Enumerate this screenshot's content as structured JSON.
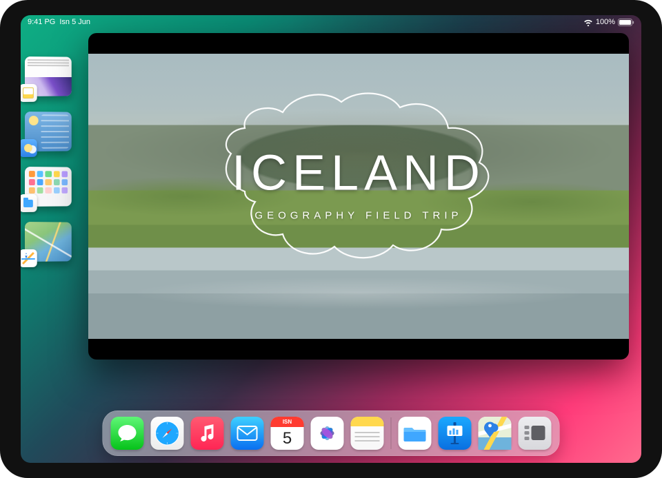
{
  "status": {
    "time": "9:41 PG",
    "date": "Isn 5 Jun",
    "battery": "100%"
  },
  "stage_stack": [
    {
      "app": "Notes",
      "icon": "notes-icon"
    },
    {
      "app": "Weather",
      "icon": "weather-icon"
    },
    {
      "app": "Files",
      "icon": "files-icon"
    },
    {
      "app": "Maps",
      "icon": "maps-icon"
    }
  ],
  "main_window": {
    "title": "ICELAND",
    "subtitle": "GEOGRAPHY FIELD TRIP"
  },
  "dock": {
    "calendar_label": "ISN",
    "calendar_day": "5",
    "apps": [
      "Messages",
      "Safari",
      "Music",
      "Mail",
      "Calendar",
      "Photos",
      "Notes"
    ],
    "recent_apps": [
      "Files",
      "Keynote",
      "Maps",
      "Stage Manager"
    ]
  }
}
